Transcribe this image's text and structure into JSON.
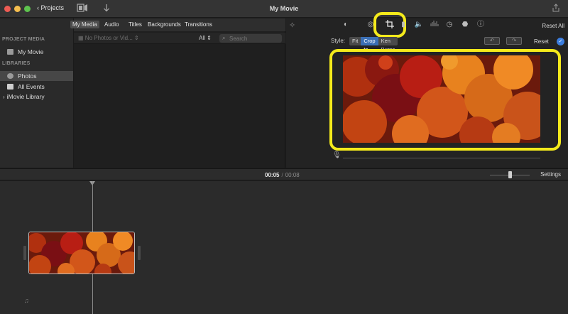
{
  "window": {
    "title": "My Movie",
    "back_label": "Projects"
  },
  "toolbar": {
    "library_icon": "film-strip-icon",
    "import_icon": "download-arrow-icon",
    "share_icon": "share-icon"
  },
  "sidebar": {
    "project_media_heading": "PROJECT MEDIA",
    "project_item": "My Movie",
    "libraries_heading": "LIBRARIES",
    "items": [
      {
        "label": "Photos",
        "selected": true
      },
      {
        "label": "All Events",
        "selected": false
      },
      {
        "label": "iMovie Library",
        "selected": false
      }
    ]
  },
  "browser": {
    "tabs": [
      {
        "label": "My Media",
        "selected": true
      },
      {
        "label": "Audio"
      },
      {
        "label": "Titles"
      },
      {
        "label": "Backgrounds"
      },
      {
        "label": "Transitions"
      }
    ],
    "filter_placeholder": "No Photos or Vid...",
    "all_label": "All",
    "search_placeholder": "Search"
  },
  "viewer": {
    "reset_all": "Reset All",
    "style_label": "Style:",
    "style_options": [
      {
        "label": "Fit",
        "selected": false
      },
      {
        "label": "Crop to Fill",
        "selected": true
      },
      {
        "label": "Ken Burns",
        "selected": false
      }
    ],
    "reset_label": "Reset",
    "check_icon": "checkmark-icon",
    "tools": [
      "color-balance-icon",
      "color-correction-icon",
      "crop-icon",
      "stabilization-icon",
      "volume-icon",
      "noise-reduction-icon",
      "speed-icon",
      "filter-icon",
      "info-icon"
    ],
    "highlight_color": "#f4ea1b"
  },
  "timeline": {
    "current_time": "00:05",
    "total_time": "00:08",
    "settings_label": "Settings"
  }
}
